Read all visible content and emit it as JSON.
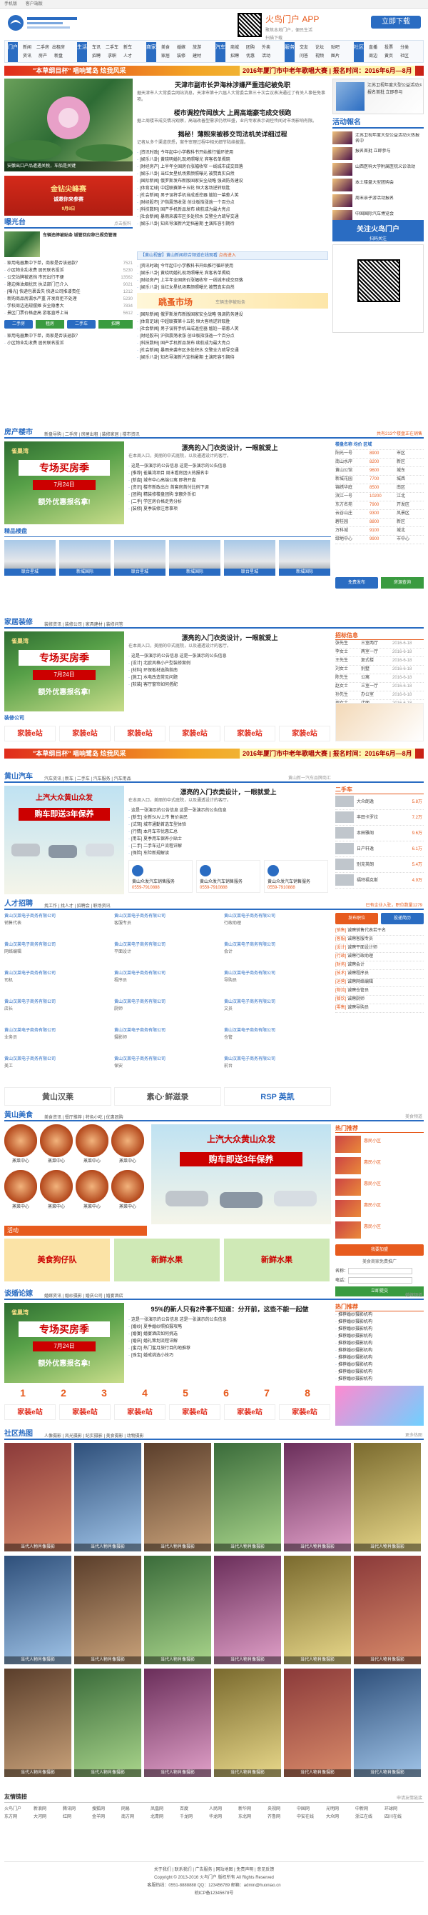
{
  "topbar": {
    "items": [
      "手机版",
      "客户端版"
    ]
  },
  "header": {
    "app_title": "火鸟门户 APP",
    "app_sub1": "聚焦本地门户，便民生活",
    "app_sub2": "扫描下载",
    "download": "立即下载"
  },
  "nav": [
    {
      "tag": "门户",
      "items": [
        "新闻",
        "二手房",
        "出租房",
        "资讯",
        "房产",
        "新盘"
      ]
    },
    {
      "tag": "生活",
      "items": [
        "车讯",
        "二手车",
        "新车",
        "招聘",
        "求职",
        "人才"
      ]
    },
    {
      "tag": "商家",
      "items": [
        "美食",
        "婚嫁",
        "旅游",
        "家居",
        "装修",
        "建材"
      ]
    },
    {
      "tag": "汽车",
      "items": [
        "商城",
        "团购",
        "外卖",
        "招聘",
        "优惠",
        "活动"
      ]
    },
    {
      "tag": "服务",
      "items": [
        "交友",
        "论坛",
        "贴吧",
        "问答",
        "视频",
        "图片"
      ]
    },
    {
      "tag": "社区",
      "items": [
        "直播",
        "投票",
        "分类",
        "周边",
        "黄页",
        "社区"
      ]
    }
  ],
  "banner1": {
    "left": "\"本草纲目杯\" 唱响鹭岛 炫我风采",
    "right": "2016年厦门市中老年歌唱大赛 | 报名时间：2016年6月—8月"
  },
  "top_news": {
    "photo_caption": "安徽出口产品遭遇关税，车船是关键",
    "headline1": "天津市副市长尹海林涉嫌严重违纪被免职",
    "sub1": "据天津市人大常委会网站消息，天津市第十六届人大常委会第三十次会议表决通过了有关人事任免事项。",
    "headline2": "楼市调控传闻放大 上周高端豪宅成交领跑",
    "sub2": "据上周楼市成交情况观察，高端改善型需求仍然旺盛，业内专家表示调控传闻对市场影响有限。",
    "headline3": "揭秘！薄熙来被移交司法机关详细过程",
    "sub3": "记者从多个渠道获悉，案件审理过程中相关细节陆续披露。",
    "news": [
      "[资讯时政] 今年起中小学教科书开始推行循环使用",
      "[娱乐八卦] 黄晓明婚礼现场照曝光 宾客名单揭晓",
      "[财经房产] 上半年全国房价涨幅收窄 一线城市成交回落",
      "[娱乐八卦] 当红女星机场素颜照曝光 被赞真实自然",
      "[国际新闻] 俄罗斯发布新版国家安全战略 强调防务建设",
      "[体育足球] 中超联赛第十五轮 恒大客场逆转取胜",
      "[社会新闻] 男子误将手机当成遥控器 尴尬一幕惹人笑",
      "[财经股市] 沪指震荡收涨 创业板指涨逾一个百分点",
      "[科技数码] 国产手机新品发布 续航成为最大亮点",
      "[社会新闻] 暴雨来袭市区多处积水 交警全力疏导交通",
      "[娱乐八卦] 知名导演新片定档暑期 主演阵容引期待"
    ]
  },
  "left_ad": {
    "line1": "金钻尖峰赛",
    "line2": "诚邀你来参赛",
    "line3": "9月8日"
  },
  "hot_section": {
    "title": "曝光台",
    "more": "点击报料",
    "lead": "车辆违停被贴条 城管回应称已规范管理",
    "items": [
      "家用电器集中下单，商家是否该退款？",
      "小区物业乱收费 居民联名投诉",
      "公交站牌被遮挡 市民出行不便",
      "路边摊油烟扰民 执法部门已介入",
      "[曝光] 快递包裹丢失 快递公司推诿责任",
      "新购商品房漏水严重 开发商拒不处理",
      "学校周边违规摆摊 安全隐患大",
      "景区门票价格虚高 游客直呼上当"
    ],
    "counts": [
      "7521",
      "5230",
      "13562",
      "9021",
      "1212",
      "5230",
      "7834",
      "5612"
    ]
  },
  "ribbon": {
    "text": "【黄山视窗】黄山新闻综合频道在线观看",
    "sub": "点击进入"
  },
  "activity": {
    "title": "活动報名"
  },
  "right_col": {
    "items": [
      "江苏卫视年度大型公益活动火热报名中",
      "报名首批 立即参与",
      "山西医科大学附属医院义诊活动",
      "本土楼盘大型团购会",
      "周末亲子游活动报名",
      "中国国际汽车博览会"
    ]
  },
  "follow": {
    "title": "关注火鸟门户",
    "sub": "扫码关注"
  },
  "market": {
    "title": "跳蚤市场",
    "subtitle": "车辆违停被贴条"
  },
  "house": {
    "title": "房产楼市",
    "tabs": "新盘导购 | 二手房 | 房屋出租 | 装修家居 | 楼市资讯",
    "more": "共有213个楼盘正在销售",
    "headline": "漂亮的入门衣类设计，一眼就爱上",
    "sub": "在本周入口，美丽的中式庭院，以及通透设计的客厅。",
    "poster": "专场买房季",
    "poster_date": "7月24日",
    "poster_sub": "额外优惠报名拿!",
    "news": [
      "这是一张演示的公告信息 这是一张演示的公告信息",
      "[推荐] 雀巢湾项目 周末看房团火热报名中",
      "[新盘] 城市中心高端公寓 即将开盘",
      "[资讯] 楼市新政出台 首套房首付比例下调",
      "[团购] 精装修楼盘团购 享额外折扣",
      "[二手] 学区房价格走势分析",
      "[装修] 夏季装修注意事项"
    ],
    "table_hdr": [
      "楼盘名称",
      "均价",
      "区域"
    ],
    "table": [
      [
        "阳光一号",
        "8900",
        "市区"
      ],
      [
        "南山水岸",
        "8200",
        "新区"
      ],
      [
        "黄山公馆",
        "9600",
        "城东"
      ],
      [
        "新城花园",
        "7700",
        "城西"
      ],
      [
        "锦绣华庭",
        "8500",
        "南区"
      ],
      [
        "滨江一号",
        "10200",
        "江北"
      ],
      [
        "东方名苑",
        "7900",
        "开发区"
      ],
      [
        "云谷山庄",
        "9300",
        "风景区"
      ],
      [
        "碧桂园",
        "8800",
        "新区"
      ],
      [
        "万科城",
        "9100",
        "城北"
      ],
      [
        "绿地中心",
        "9900",
        "市中心"
      ]
    ],
    "gallery_title": "精品楼盘",
    "gallery": [
      "联台星城",
      "新城国际",
      "联台星城",
      "新城国际",
      "联台星城",
      "新城国际"
    ],
    "btn": [
      "免费发布",
      "房源查询"
    ]
  },
  "decor": {
    "title": "家居装修",
    "tabs": "装修资讯 | 装修公司 | 家具建材 | 装修问答",
    "more": "装修公司 · 建材商家",
    "headline": "漂亮的入门衣类设计，一眼就爱上",
    "sub": "在本周入口，美丽的中式庭院，以及通透设计的客厅。",
    "news": [
      "这是一张演示的公告信息 这是一张演示的公告信息",
      "[设计] 北欧风格小户型装修案例",
      "[材料] 环保板材选购指南",
      "[施工] 水电改造常见问题",
      "[软装] 客厅窗帘如何搭配"
    ],
    "right_hdr": "招标信息",
    "right_items": [
      [
        "张先生",
        "三室两厅",
        "2016-6-18"
      ],
      [
        "李女士",
        "两室一厅",
        "2016-6-18"
      ],
      [
        "王先生",
        "复式楼",
        "2016-6-18"
      ],
      [
        "刘女士",
        "别墅",
        "2016-6-18"
      ],
      [
        "陈先生",
        "公寓",
        "2016-6-18"
      ],
      [
        "赵女士",
        "三室一厅",
        "2016-6-18"
      ],
      [
        "孙先生",
        "办公室",
        "2016-6-18"
      ],
      [
        "周女士",
        "店面",
        "2016-6-18"
      ]
    ],
    "sub_title": "装修公司",
    "logos": [
      "家装e站",
      "家装e站",
      "家装e站",
      "家装e站",
      "家装e站",
      "家装e站"
    ]
  },
  "car": {
    "title": "黄山汽车",
    "tabs": "汽车资讯 | 新车 | 二手车 | 汽车服务 | 汽车用品",
    "more": "黄山新一汽车品牌商汇",
    "poster_title": "上汽大众黄山众发",
    "poster_sub": "购车即送3年保养",
    "headline": "漂亮的入门衣类设计，一眼就爱上",
    "sub": "在本周入口，美丽的中式庭院，以及通透设计的客厅。",
    "news": [
      "这是一张演示的公告信息 这是一张演示的公告信息",
      "[新车] 全新SUV上市 售价亲民",
      "[试驾] 城市通勤首选车型体验",
      "[行情] 本月车市优惠汇总",
      "[用车] 夏季用车保养小贴士",
      "[二手] 二手车过户流程详解",
      "[保险] 车险新规解读"
    ],
    "dealers": [
      [
        "黄山众发汽车销售服务",
        "0559-7910888"
      ],
      [
        "黄山众发汽车销售服务",
        "0559-7910888"
      ],
      [
        "黄山众发汽车销售服务",
        "0559-7910888"
      ]
    ],
    "right_title": "二手车",
    "right_items": [
      [
        "大众朗逸",
        "5.8万"
      ],
      [
        "丰田卡罗拉",
        "7.2万"
      ],
      [
        "本田雅阁",
        "9.6万"
      ],
      [
        "日产轩逸",
        "6.1万"
      ],
      [
        "别克英朗",
        "5.4万"
      ],
      [
        "福特福克斯",
        "4.9万"
      ]
    ]
  },
  "jobs": {
    "title": "人才招聘",
    "tabs": "找工作 | 找人才 | 招聘会 | 职场资讯",
    "more": "已有企业入驻，职位数量1279",
    "companies": [
      [
        "黄山汉莱电子商务有限公司",
        "销售代表"
      ],
      [
        "黄山汉莱电子商务有限公司",
        "客服专员"
      ],
      [
        "黄山汉莱电子商务有限公司",
        "行政助理"
      ],
      [
        "黄山汉莱电子商务有限公司",
        "网络编辑"
      ],
      [
        "黄山汉莱电子商务有限公司",
        "平面设计"
      ],
      [
        "黄山汉莱电子商务有限公司",
        "会计"
      ],
      [
        "黄山汉莱电子商务有限公司",
        "司机"
      ],
      [
        "黄山汉莱电子商务有限公司",
        "程序员"
      ],
      [
        "黄山汉莱电子商务有限公司",
        "导购员"
      ],
      [
        "黄山汉莱电子商务有限公司",
        "店长"
      ],
      [
        "黄山汉莱电子商务有限公司",
        "厨师"
      ],
      [
        "黄山汉莱电子商务有限公司",
        "文员"
      ],
      [
        "黄山汉莱电子商务有限公司",
        "业务员"
      ],
      [
        "黄山汉莱电子商务有限公司",
        "摄影师"
      ],
      [
        "黄山汉莱电子商务有限公司",
        "仓管"
      ],
      [
        "黄山汉莱电子商务有限公司",
        "美工"
      ],
      [
        "黄山汉莱电子商务有限公司",
        "保安"
      ],
      [
        "黄山汉莱电子商务有限公司",
        "前台"
      ]
    ],
    "right_btns": [
      "发布职位",
      "投递简历"
    ],
    "right_list": [
      [
        "销售",
        "诚聘销售代表若干名"
      ],
      [
        "客服",
        "诚聘客服专员"
      ],
      [
        "设计",
        "诚聘平面设计师"
      ],
      [
        "行政",
        "诚聘行政助理"
      ],
      [
        "财务",
        "诚聘会计"
      ],
      [
        "技术",
        "诚聘程序员"
      ],
      [
        "运营",
        "诚聘网络编辑"
      ],
      [
        "物流",
        "诚聘仓管员"
      ],
      [
        "餐饮",
        "诚聘厨师"
      ],
      [
        "零售",
        "诚聘导购员"
      ]
    ],
    "logos": [
      "黄山汉莱",
      "素心·鲜滋录",
      "RSP 英凯"
    ]
  },
  "food": {
    "title": "黄山美食",
    "tabs": "美食资讯 | 餐厅推荐 | 特色小吃 | 优惠团购",
    "more": "美食频道",
    "items": [
      "蒸菜中心",
      "蒸菜中心",
      "蒸菜中心",
      "蒸菜中心",
      "蒸菜中心",
      "蒸菜中心",
      "蒸菜中心",
      "蒸菜中心"
    ],
    "activity_title": "活动",
    "poster_title": "上汽大众黄山众发",
    "poster_sub": "购车即送3年保养",
    "mini": [
      "美食狗仔队",
      "新鲜水果",
      "新鲜水果"
    ],
    "right_hdr": "热门推荐",
    "right_items": [
      "惠民小区",
      "惠民小区",
      "惠民小区",
      "惠民小区",
      "惠民小区"
    ],
    "join": "我要加盟",
    "join_sub": "美食商家免费推广",
    "name_label": "名称",
    "phone_label": "电话",
    "submit": "立即提交"
  },
  "forum": {
    "title": "谈婚论嫁",
    "tabs": "婚嫁资讯 | 婚纱摄影 | 婚庆公司 | 婚宴酒店",
    "more": "婚嫁频道",
    "headline": "95%的新人只有2件事不知道：分开前，这些不能一起做",
    "news": [
      "这是一张演示的公告信息 这是一张演示的公告信息",
      "[婚纱] 夏季婚纱照拍摄攻略",
      "[婚宴] 婚宴酒店如何挑选",
      "[婚庆] 婚礼策划流程详解",
      "[蜜月] 热门蜜月旅行目的地推荐",
      "[珠宝] 婚戒挑选小技巧"
    ],
    "numbers": [
      "1",
      "2",
      "3",
      "4",
      "5",
      "6",
      "7",
      "8"
    ],
    "logos": [
      "家装e站",
      "家装e站",
      "家装e站",
      "家装e站",
      "家装e站",
      "家装e站"
    ],
    "right_hdr": "热门推荐",
    "right_items": [
      "推荐婚纱摄影机构",
      "推荐婚纱摄影机构",
      "推荐婚纱摄影机构",
      "推荐婚纱摄影机构",
      "推荐婚纱摄影机构",
      "推荐婚纱摄影机构",
      "推荐婚纱摄影机构",
      "推荐婚纱摄影机构",
      "推荐婚纱摄影机构",
      "推荐婚纱摄影机构"
    ]
  },
  "photos": {
    "title": "社区热图",
    "tabs": "人像摄影 | 风光摄影 | 纪实摄影 | 美食摄影 | 动物摄影",
    "more": "更多热图",
    "caption": "当代人物肖像摄影"
  },
  "links": {
    "title": "友情链接",
    "more": "申请友情链接",
    "items": [
      "火鸟门户",
      "新浪网",
      "腾讯网",
      "搜狐网",
      "网易",
      "凤凰网",
      "百度",
      "人民网",
      "新华网",
      "央视网",
      "中国网",
      "光明网",
      "中新网",
      "环球网",
      "东方网",
      "大河网",
      "红网",
      "金羊网",
      "南方网",
      "北青网",
      "千龙网",
      "华龙网",
      "东北网",
      "齐鲁网",
      "中安在线",
      "大众网",
      "浙江在线",
      "四川在线"
    ]
  },
  "footer": {
    "line1": "关于我们 | 联系我们 | 广告服务 | 网站地图 | 免责声明 | 意见反馈",
    "line2": "Copyright © 2013-2016 火鸟门户 版权所有 All Rights Reserved",
    "line3": "客服热线：0551-8888888  QQ：123456789  邮箱：admin@huoniao.cn",
    "line4": "皖ICP备12345678号"
  }
}
